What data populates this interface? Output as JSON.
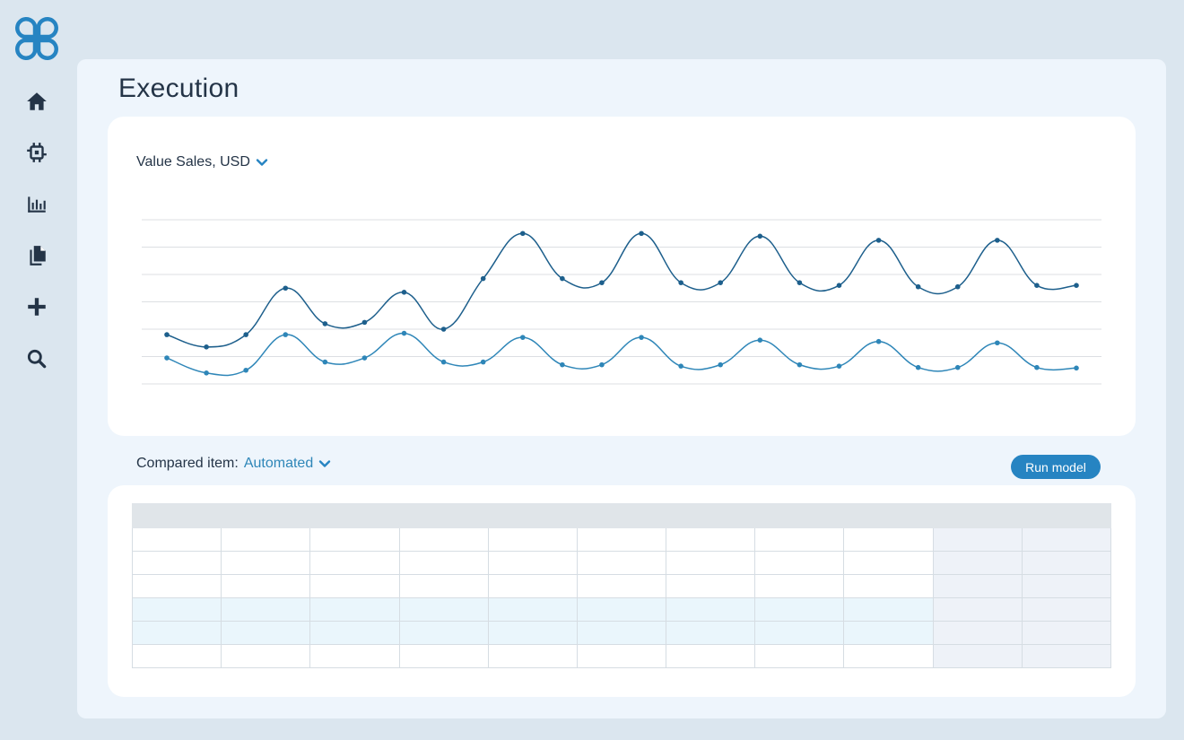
{
  "page": {
    "title": "Execution"
  },
  "sidebar": {
    "logo": "clover-logo",
    "items": [
      {
        "icon": "home-icon"
      },
      {
        "icon": "chip-icon"
      },
      {
        "icon": "bar-chart-icon"
      },
      {
        "icon": "documents-icon"
      },
      {
        "icon": "plus-icon"
      },
      {
        "icon": "search-icon"
      }
    ]
  },
  "chart": {
    "metric_label": "Value Sales, USD",
    "colors": {
      "series_a": "#1d5f8c",
      "series_b": "#2e86b8",
      "grid": "#dcdfe3"
    }
  },
  "chart_data": {
    "type": "line",
    "title": "",
    "xlabel": "",
    "ylabel": "",
    "ylim": [
      0,
      6
    ],
    "grid": true,
    "legend": "none",
    "x": [
      1,
      2,
      3,
      4,
      5,
      6,
      7,
      8,
      9,
      10,
      11,
      12,
      13,
      14,
      15,
      16,
      17,
      18,
      19,
      20,
      21,
      22,
      23,
      24,
      25
    ],
    "series": [
      {
        "values": [
          1.8,
          1.35,
          1.8,
          3.5,
          2.2,
          2.25,
          3.35,
          2.0,
          3.85,
          5.5,
          3.85,
          3.7,
          5.5,
          3.7,
          3.7,
          5.4,
          3.7,
          3.6,
          5.25,
          3.55,
          3.55,
          5.25,
          3.6,
          3.6
        ]
      },
      {
        "values": [
          0.95,
          0.4,
          0.5,
          1.8,
          0.8,
          0.95,
          1.85,
          0.8,
          0.8,
          1.7,
          0.7,
          0.7,
          1.7,
          0.65,
          0.7,
          1.6,
          0.7,
          0.65,
          1.55,
          0.6,
          0.6,
          1.5,
          0.6,
          0.58
        ]
      }
    ]
  },
  "compare": {
    "label": "Compared item:",
    "value": "Automated",
    "run_button": "Run model"
  },
  "table": {
    "header_cells": [
      "",
      "",
      "",
      "",
      "",
      "",
      "",
      "",
      "",
      "",
      ""
    ],
    "rows": [
      [
        "",
        "",
        "",
        "",
        "",
        "",
        "",
        "",
        "",
        "",
        ""
      ],
      [
        "",
        "",
        "",
        "",
        "",
        "",
        "",
        "",
        "",
        "",
        ""
      ],
      [
        "",
        "",
        "",
        "",
        "",
        "",
        "",
        "",
        "",
        "",
        ""
      ],
      [
        "",
        "",
        "",
        "",
        "",
        "",
        "",
        "",
        "",
        "",
        ""
      ],
      [
        "",
        "",
        "",
        "",
        "",
        "",
        "",
        "",
        "",
        "",
        ""
      ],
      [
        "",
        "",
        "",
        "",
        "",
        "",
        "",
        "",
        "",
        "",
        ""
      ]
    ],
    "highlighted_rows": [
      3,
      4
    ],
    "shaded_columns": [
      9,
      10
    ]
  }
}
